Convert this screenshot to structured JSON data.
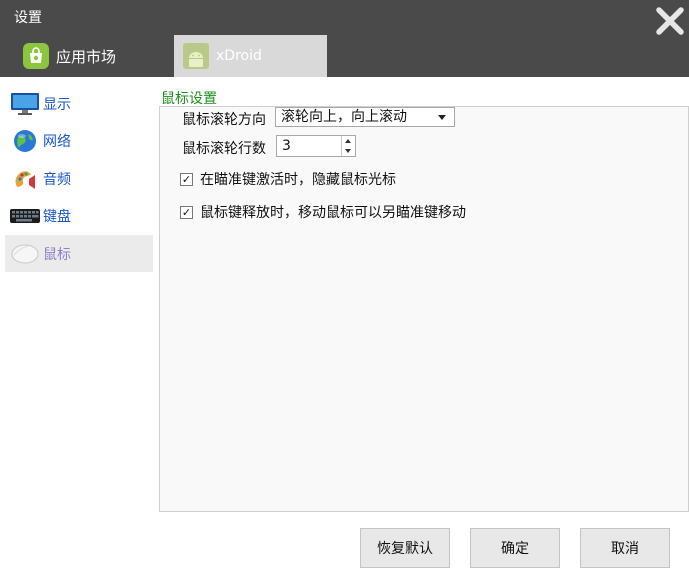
{
  "window": {
    "title": "设置"
  },
  "tabs": [
    {
      "label": "应用市场",
      "icon": "app-market-icon"
    },
    {
      "label": "xDroid",
      "icon": "android-icon"
    }
  ],
  "sidebar": {
    "items": [
      {
        "label": "显示",
        "icon": "monitor-icon"
      },
      {
        "label": "网络",
        "icon": "globe-icon"
      },
      {
        "label": "音频",
        "icon": "audio-icon"
      },
      {
        "label": "键盘",
        "icon": "keyboard-icon"
      },
      {
        "label": "鼠标",
        "icon": "mouse-icon"
      }
    ]
  },
  "mouse_settings": {
    "section_title": "鼠标设置",
    "scroll_direction_label": "鼠标滚轮方向",
    "scroll_direction_value": "滚轮向上，向上滚动",
    "scroll_lines_label": "鼠标滚轮行数",
    "scroll_lines_value": "3",
    "options": [
      {
        "label": "在瞄准键激活时，隐藏鼠标光标",
        "checked": true
      },
      {
        "label": "鼠标键释放时，移动鼠标可以另瞄准键移动",
        "checked": true
      }
    ]
  },
  "buttons": {
    "reset": "恢复默认",
    "ok": "确定",
    "cancel": "取消"
  },
  "colors": {
    "titlebar": "#4a4a4a",
    "active_tab": "#d9d9d9",
    "sidebar_link": "#1a56c8",
    "section_title": "#1e8c1e"
  }
}
